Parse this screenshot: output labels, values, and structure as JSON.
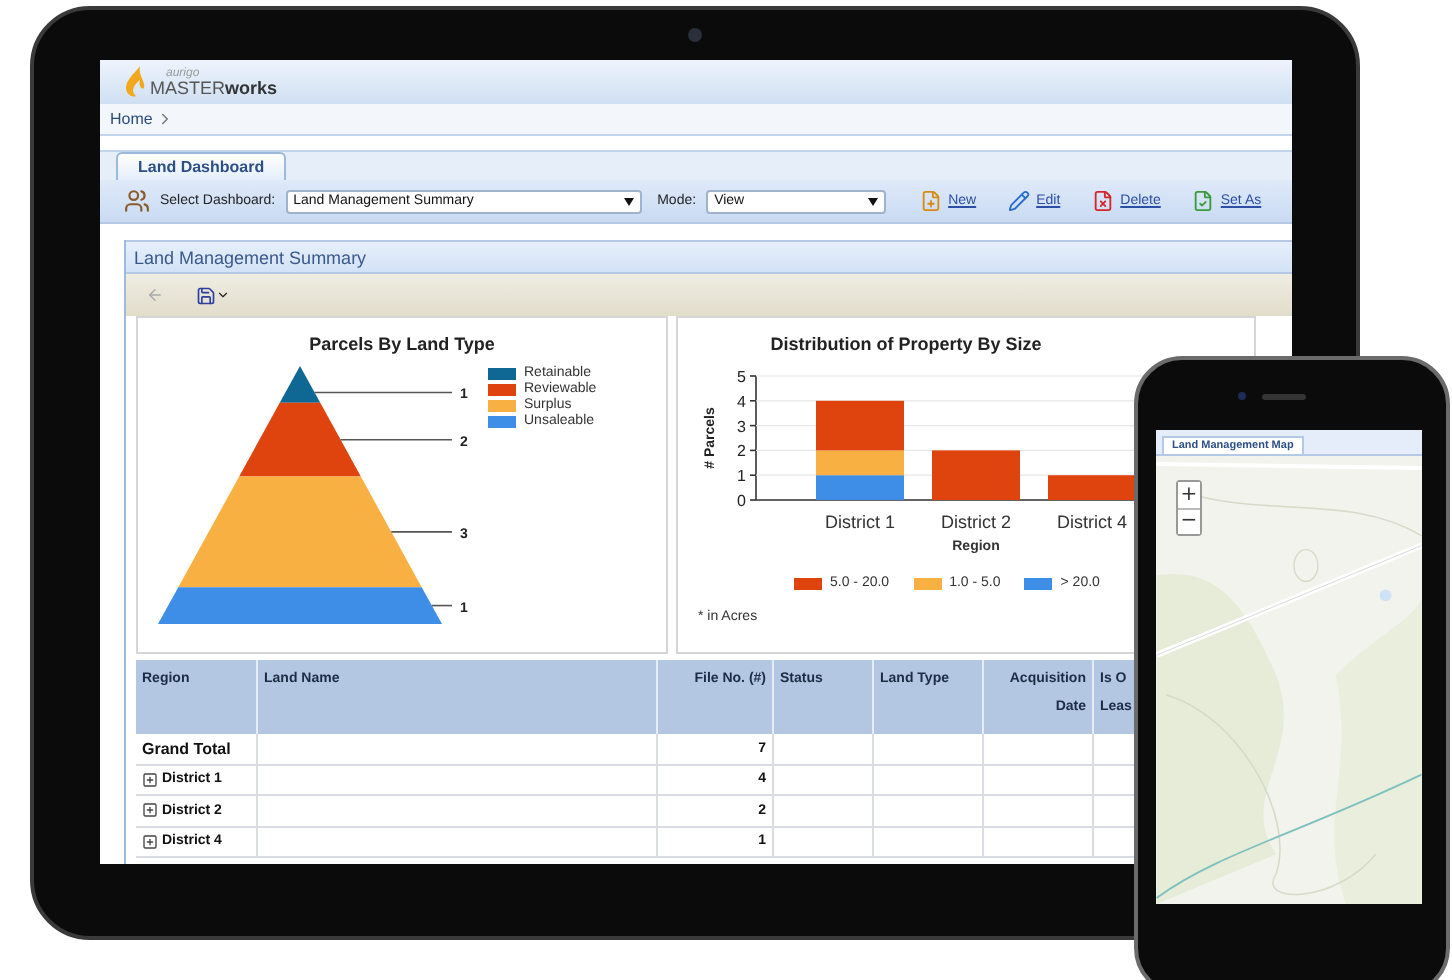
{
  "header": {
    "logo": {
      "tagline": "aurigo",
      "name_light": "MASTER",
      "name_bold": "works"
    }
  },
  "breadcrumb": [
    {
      "label": "Home"
    }
  ],
  "tabs": [
    {
      "label": "Land Dashboard",
      "selected": true
    }
  ],
  "toolbar": {
    "dashboard_label": "Select Dashboard:",
    "dashboard_value": "Land Management Summary",
    "mode_label": "Mode:",
    "mode_value": "View",
    "actions": [
      {
        "kind": "new",
        "label": "New"
      },
      {
        "kind": "edit",
        "label": "Edit"
      },
      {
        "kind": "delete",
        "label": "Delete"
      },
      {
        "kind": "set",
        "label": "Set As"
      }
    ]
  },
  "panel": {
    "title": "Land Management Summary",
    "pyramid": {
      "title": "Parcels By Land Type",
      "segments": [
        {
          "label": "Retainable",
          "value": "1",
          "color": "#0e6893"
        },
        {
          "label": "Reviewable",
          "value": "2",
          "color": "#e0440e"
        },
        {
          "label": "Surplus",
          "value": "3",
          "color": "#f9b042"
        },
        {
          "label": "Unsaleable",
          "value": "1",
          "color": "#3e8ee8"
        }
      ]
    },
    "bar_chart": {
      "chart_data": {
        "type": "bar",
        "title": "Distribution of Property By Size",
        "xlabel": "Region",
        "ylabel": "# Parcels",
        "categories": [
          "District 1",
          "District 2",
          "District 4"
        ],
        "stacked": true,
        "grid": true,
        "ylim": [
          0,
          5
        ],
        "yticks": [
          0,
          1,
          2,
          3,
          4,
          5
        ],
        "series": [
          {
            "name": "5.0 - 20.0",
            "color": "#e0440e",
            "values": [
              2,
              2,
              1
            ]
          },
          {
            "name": "1.0 - 5.0",
            "color": "#f9b042",
            "values": [
              1,
              0,
              0
            ]
          },
          {
            "name": "> 20.0",
            "color": "#3e8ee8",
            "values": [
              1,
              0,
              0
            ]
          }
        ]
      },
      "note": "* in Acres"
    },
    "table": {
      "columns": [
        {
          "lines": [
            "Region"
          ]
        },
        {
          "lines": [
            "Land Name"
          ]
        },
        {
          "lines": [
            "File No. (#)"
          ]
        },
        {
          "lines": [
            "Status"
          ]
        },
        {
          "lines": [
            "Land Type"
          ]
        },
        {
          "lines": [
            "Acquisition",
            "Date"
          ]
        },
        {
          "lines": [
            "Is O",
            "Leas"
          ]
        }
      ],
      "rows": [
        {
          "kind": "total",
          "region": "Grand Total",
          "file_no": "7"
        },
        {
          "kind": "group",
          "region": "District 1",
          "expanded": false,
          "file_no": "4"
        },
        {
          "kind": "group",
          "region": "District 2",
          "expanded": false,
          "file_no": "2"
        },
        {
          "kind": "group",
          "region": "District 4",
          "expanded": false,
          "file_no": "1"
        }
      ]
    }
  },
  "phone": {
    "tab": "Land Management Map",
    "zoom_in": "+",
    "zoom_out": "−"
  }
}
